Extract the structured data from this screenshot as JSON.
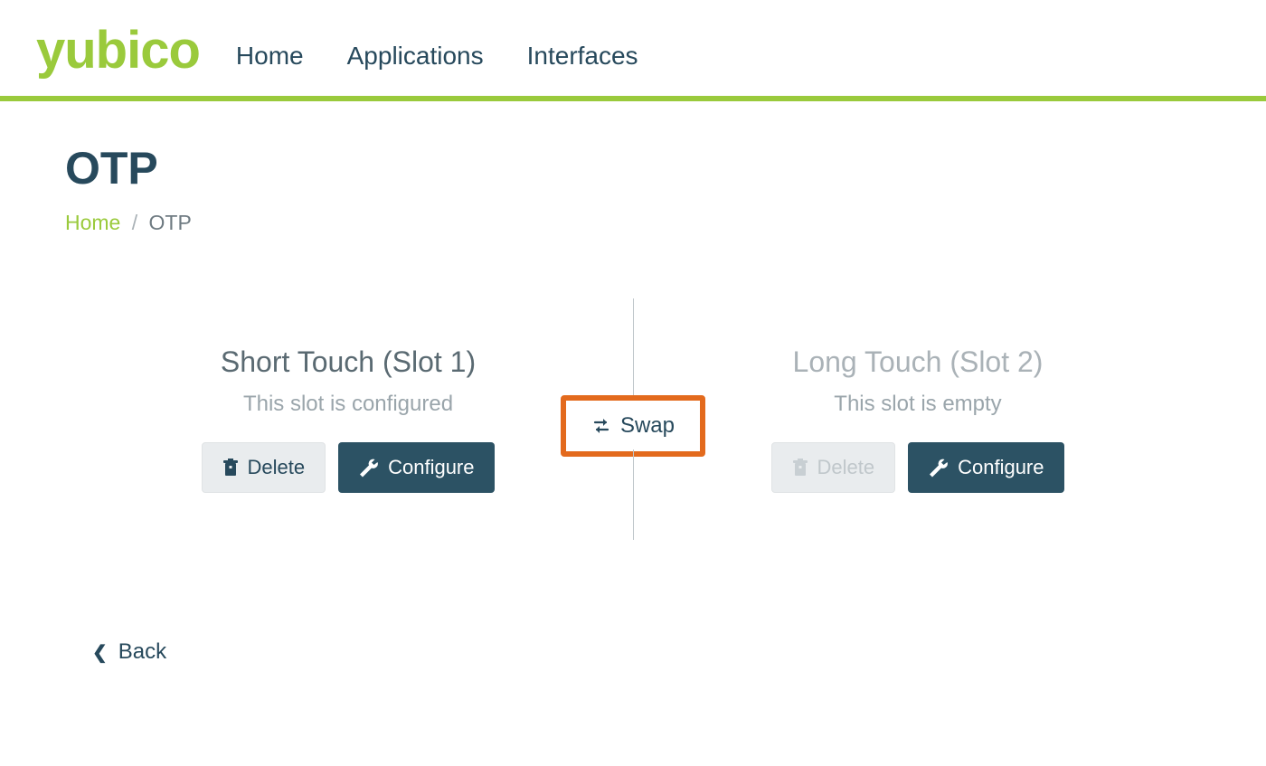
{
  "brand": "yubico",
  "nav": {
    "home": "Home",
    "applications": "Applications",
    "interfaces": "Interfaces"
  },
  "page": {
    "title": "OTP"
  },
  "breadcrumb": {
    "home": "Home",
    "current": "OTP"
  },
  "slots": {
    "slot1": {
      "title": "Short Touch (Slot 1)",
      "status": "This slot is configured",
      "delete_label": "Delete",
      "configure_label": "Configure"
    },
    "slot2": {
      "title": "Long Touch (Slot 2)",
      "status": "This slot is empty",
      "delete_label": "Delete",
      "configure_label": "Configure"
    },
    "swap_label": "Swap"
  },
  "back_label": "Back",
  "colors": {
    "brand_green": "#9aca3c",
    "primary_dark": "#27495c",
    "highlight_orange": "#e36a1d"
  }
}
